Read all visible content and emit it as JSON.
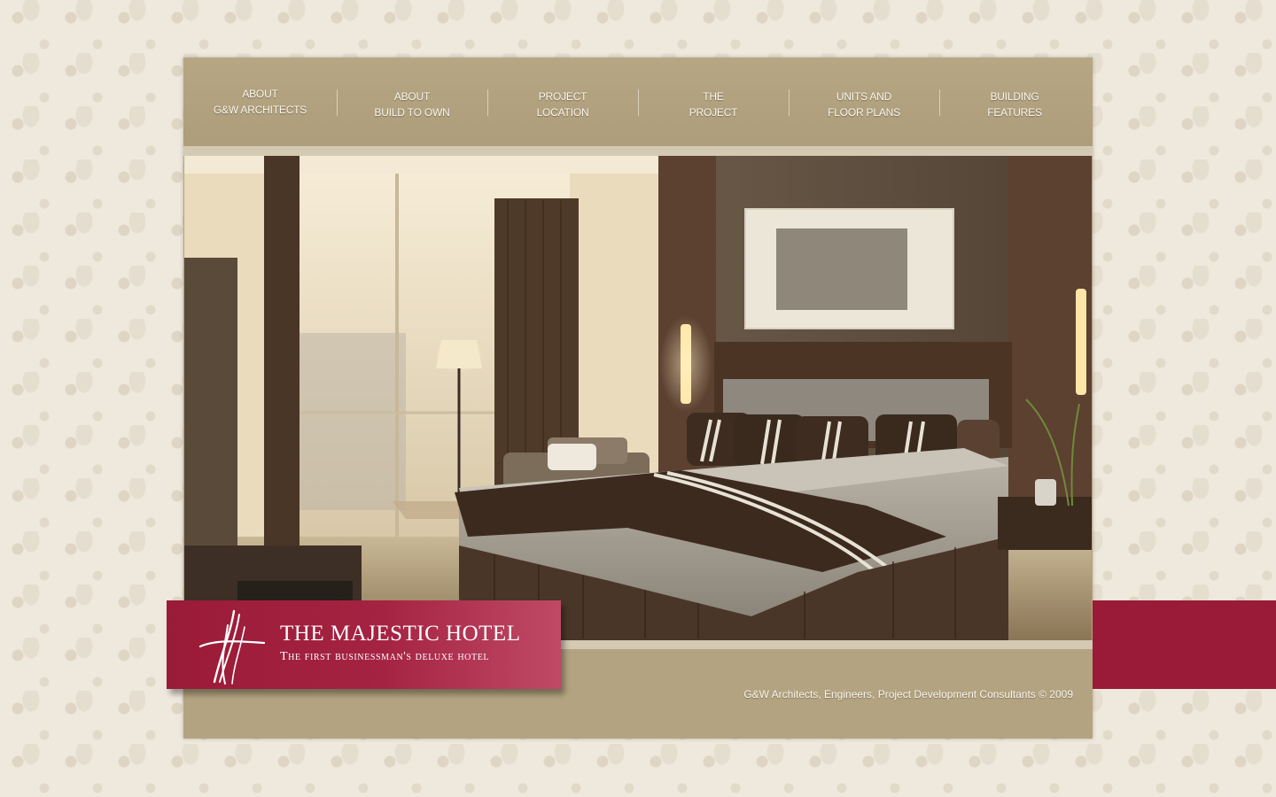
{
  "nav": {
    "items": [
      {
        "line1": "ABOUT",
        "line2": "G&W ARCHITECTS"
      },
      {
        "line1": "ABOUT",
        "line2": "BUILD TO OWN"
      },
      {
        "line1": "PROJECT",
        "line2": "LOCATION"
      },
      {
        "line1": "THE",
        "line2": "PROJECT"
      },
      {
        "line1": "UNITS AND",
        "line2": "FLOOR PLANS"
      },
      {
        "line1": "BUILDING",
        "line2": "FEATURES"
      }
    ]
  },
  "hero": {
    "subject": "hotel-room-interior-photo"
  },
  "brand": {
    "title": "THE MAJESTIC HOTEL",
    "tagline": "The first businessman's deluxe hotel",
    "accent_color": "#9a1b37"
  },
  "footer": {
    "copyright": "G&W Architects, Engineers, Project Development Consultants © 2009"
  },
  "colors": {
    "frame": "#b3a381",
    "strip": "#d4c9b3",
    "background": "#efe9dd",
    "accent": "#9a1b37"
  }
}
